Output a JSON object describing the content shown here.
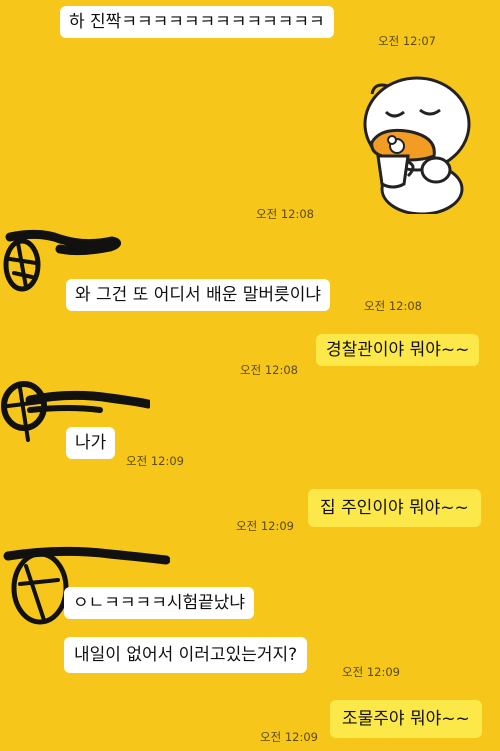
{
  "chat": {
    "messages": [
      {
        "side": "in",
        "text": "하 진짝ㅋㅋㅋㅋㅋㅋㅋㅋㅋㅋㅋㅋㅋ",
        "time": "오전 12:07"
      },
      {
        "side": "in",
        "sticker": "ryan-drinking-tea-sticker",
        "time": "오전 12:08"
      },
      {
        "side": "in",
        "text": "와 그건 또 어디서 배운 말버릇이냐",
        "time": "오전 12:08"
      },
      {
        "side": "out",
        "text": "경찰관이야 뭐야~~",
        "time": "오전 12:08"
      },
      {
        "side": "in",
        "text": "나가",
        "time": "오전 12:09"
      },
      {
        "side": "out",
        "text": "집 주인이야 뭐야~~",
        "time": "오전 12:09"
      },
      {
        "side": "in",
        "text": "ㅇㄴㅋㅋㅋㅋ시험끝났냐"
      },
      {
        "side": "in",
        "text": "내일이 없어서 이러고있는거지?",
        "time": "오전 12:09"
      },
      {
        "side": "out",
        "text": "조물주야 뭐야~~",
        "time": "오전 12:09"
      }
    ]
  },
  "colors": {
    "background": "#f6c71a",
    "incoming_bubble": "#ffffff",
    "outgoing_bubble": "#fde84a",
    "censor_scribble": "#111111"
  }
}
